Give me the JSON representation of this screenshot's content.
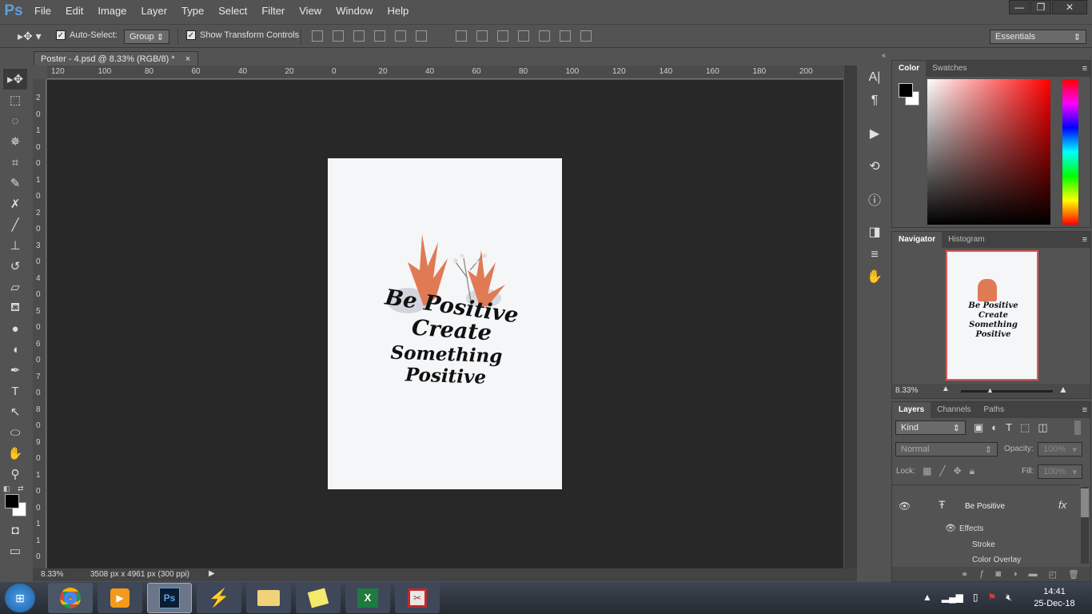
{
  "app": {
    "logo": "Ps"
  },
  "menu": [
    "File",
    "Edit",
    "Image",
    "Layer",
    "Type",
    "Select",
    "Filter",
    "View",
    "Window",
    "Help"
  ],
  "window_controls": {
    "minimize": "—",
    "restore": "❐",
    "close": "✕"
  },
  "options": {
    "auto_select_label": "Auto-Select:",
    "auto_select_value": "Group",
    "show_transform_label": "Show Transform Controls",
    "workspace": "Essentials"
  },
  "document": {
    "tab_title": "Poster - 4.psd @ 8.33% (RGB/8) *",
    "close_glyph": "×",
    "zoom": "8.33%",
    "dimensions": "3508 px x 4961 px (300 ppi)",
    "h_ruler": [
      "120",
      "100",
      "80",
      "60",
      "40",
      "20",
      "0",
      "20",
      "40",
      "60",
      "80",
      "100",
      "120",
      "140",
      "160",
      "180",
      "200"
    ],
    "v_ruler": [
      "2",
      "0",
      "1",
      "0",
      "0",
      "1",
      "0",
      "2",
      "0",
      "3",
      "0",
      "4",
      "0",
      "5",
      "0",
      "6",
      "0",
      "7",
      "0",
      "8",
      "0",
      "9",
      "0",
      "1",
      "0",
      "0",
      "1",
      "1",
      "0"
    ]
  },
  "poster": {
    "line1": "Be Positive",
    "line2": "Create",
    "line3": "Something Positive"
  },
  "color_panel": {
    "tabs": [
      "Color",
      "Swatches"
    ]
  },
  "navigator_panel": {
    "tabs": [
      "Navigator",
      "Histogram"
    ],
    "zoom": "8.33%"
  },
  "layers_panel": {
    "tabs": [
      "Layers",
      "Channels",
      "Paths"
    ],
    "filter": "Kind",
    "blend_mode": "Normal",
    "opacity_label": "Opacity:",
    "opacity_value": "100%",
    "lock_label": "Lock:",
    "fill_label": "Fill:",
    "fill_value": "100%",
    "layer_name": "Be Positive",
    "fx": "fx",
    "effects_label": "Effects",
    "effects": [
      "Stroke",
      "Color Overlay"
    ]
  },
  "taskbar": {
    "time": "14:41",
    "date": "25-Dec-18"
  },
  "colors": {
    "accent_red": "#e03030",
    "ps_blue": "#5fa0dc",
    "poster_bg": "#f4f6f8"
  }
}
